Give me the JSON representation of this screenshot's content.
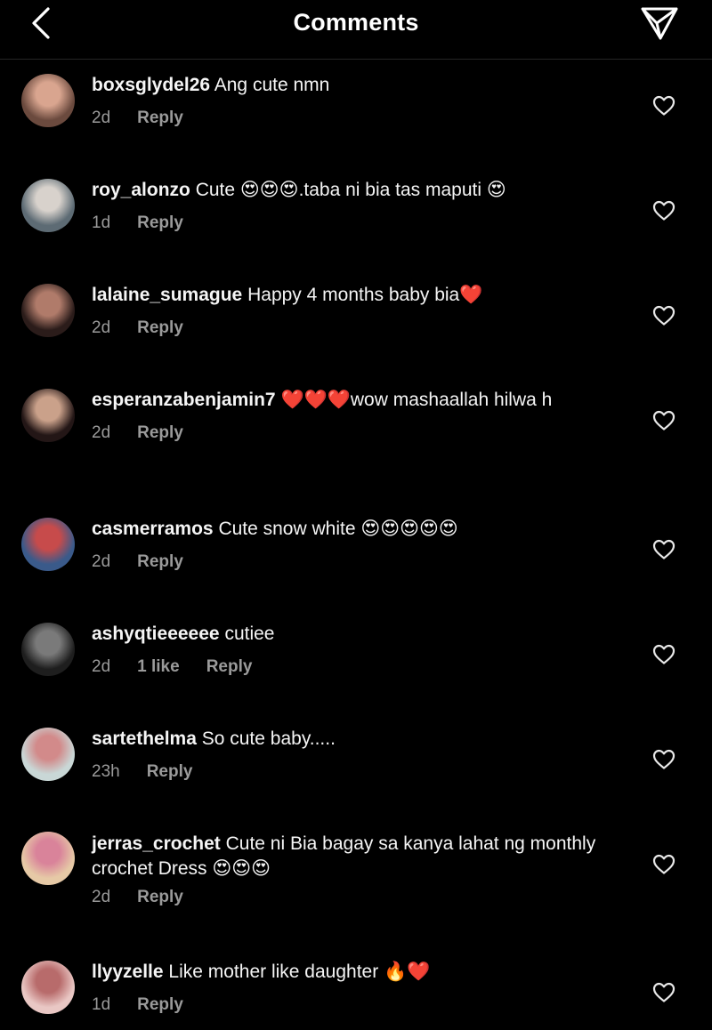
{
  "header": {
    "title": "Comments",
    "back_icon": "chevron-left-icon",
    "send_icon": "paper-plane-icon"
  },
  "reply_label": "Reply",
  "comments": [
    {
      "username": "boxsglydel26",
      "text": "Ang cute nmn",
      "time": "2d",
      "likes": "",
      "avatar_colors": [
        "#6b4a3e",
        "#d9a58f"
      ]
    },
    {
      "username": "roy_alonzo",
      "text": "Cute 😍😍😍.taba ni bia tas maputi 😍",
      "time": "1d",
      "likes": "",
      "avatar_colors": [
        "#5d6b74",
        "#d8d2cc"
      ]
    },
    {
      "username": "lalaine_sumague",
      "text": "Happy 4 months baby bia❤️",
      "time": "2d",
      "likes": "",
      "avatar_colors": [
        "#2b1c1a",
        "#b07b6a"
      ]
    },
    {
      "username": "esperanzabenjamin7",
      "text": "❤️❤️❤️wow mashaallah hilwa h",
      "time": "2d",
      "likes": "",
      "avatar_colors": [
        "#231616",
        "#caa18a"
      ]
    },
    {
      "username": "casmerramos",
      "text": "Cute snow white 😍😍😍😍😍",
      "time": "2d",
      "likes": "",
      "avatar_colors": [
        "#3a5a8a",
        "#c74b4b"
      ]
    },
    {
      "username": "ashyqtieeeeee",
      "text": "cutiee",
      "time": "2d",
      "likes": "1 like",
      "avatar_colors": [
        "#1e1e1e",
        "#7a7a7a"
      ]
    },
    {
      "username": "sartethelma",
      "text": "So cute baby.....",
      "time": "23h",
      "likes": "",
      "avatar_colors": [
        "#c9d7d6",
        "#d28a8a"
      ]
    },
    {
      "username": "jerras_crochet",
      "text": "Cute ni Bia bagay sa kanya lahat ng monthly crochet Dress 😍😍😍",
      "time": "2d",
      "likes": "",
      "avatar_colors": [
        "#e6c9a6",
        "#d9839a"
      ]
    },
    {
      "username": "llyyzelle",
      "text": "Like mother like daughter 🔥❤️",
      "time": "1d",
      "likes": "",
      "avatar_colors": [
        "#e9c7c4",
        "#b86b6b"
      ]
    }
  ]
}
